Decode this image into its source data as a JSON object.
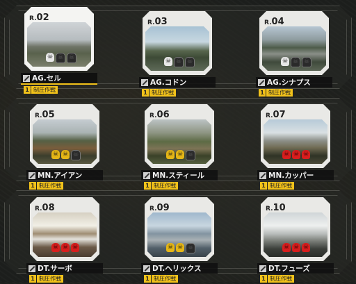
{
  "maps": [
    {
      "r": "R.",
      "num": "02",
      "name": "AG.セル",
      "mode": "制圧作戦",
      "count": "1",
      "skulls": [
        "white",
        "empty",
        "empty"
      ],
      "selected": true,
      "photo": "linear-gradient(180deg,#cfd3d6 0%,#b6bcbf 40%,#6f7468 55%,#59624c 70%,#7b7f6c 100%)"
    },
    {
      "r": "R.",
      "num": "03",
      "name": "AG.コドン",
      "mode": "制圧作戦",
      "count": "1",
      "skulls": [
        "white",
        "empty",
        "empty"
      ],
      "selected": false,
      "photo": "linear-gradient(180deg,#a7c2d4 0%,#c7d7e0 35%,#57664d 55%,#3d4a36 70%,#5e6a58 100%)"
    },
    {
      "r": "R.",
      "num": "04",
      "name": "AG.シナプス",
      "mode": "制圧作戦",
      "count": "1",
      "skulls": [
        "white",
        "empty",
        "empty"
      ],
      "selected": false,
      "photo": "linear-gradient(180deg,#b6c6d2 0%,#8f9c9f 30%,#4e5c4a 48%,#8a8f88 62%,#3f4a3b 80%,#5c6656 100%)"
    },
    {
      "r": "R.",
      "num": "05",
      "name": "MN.アイアン",
      "mode": "制圧作戦",
      "count": "1",
      "skulls": [
        "gold",
        "gold",
        "empty"
      ],
      "selected": false,
      "photo": "linear-gradient(180deg,#c5ccd1 0%,#aab3b3 30%,#556045 48%,#7a5d3c 65%,#3a3d2c 82%,#5a5940 100%)"
    },
    {
      "r": "R.",
      "num": "06",
      "name": "MN.スティール",
      "mode": "制圧作戦",
      "count": "1",
      "skulls": [
        "gold",
        "gold",
        "empty"
      ],
      "selected": false,
      "photo": "linear-gradient(180deg,#bcc3c4 0%,#8e9583 30%,#5d6a45 50%,#7d7456 66%,#3a4128 82%,#56603e 100%)"
    },
    {
      "r": "R.",
      "num": "07",
      "name": "MN.カッパー",
      "mode": "制圧作戦",
      "count": "1",
      "skulls": [
        "red",
        "red",
        "red"
      ],
      "selected": false,
      "photo": "linear-gradient(180deg,#b7cad8 0%,#d9e0e3 30%,#8c8f88 48%,#6f6a52 64%,#2f3325 82%,#4b4a38 100%)"
    },
    {
      "r": "R.",
      "num": "08",
      "name": "DT.サーボ",
      "mode": "制圧作戦",
      "count": "1",
      "skulls": [
        "red",
        "red",
        "red"
      ],
      "selected": false,
      "photo": "linear-gradient(180deg,#d6d0c2 0%,#f1efe6 30%,#9f8e74 48%,#e4e2dc 60%,#6b5a48 78%,#4a3d30 100%)"
    },
    {
      "r": "R.",
      "num": "09",
      "name": "DT.ヘリックス",
      "mode": "制圧作戦",
      "count": "1",
      "skulls": [
        "gold",
        "gold",
        "empty"
      ],
      "selected": false,
      "photo": "linear-gradient(180deg,#9fb7cc 0%,#c8d6e0 30%,#8294a1 48%,#a8b0b4 62%,#53606a 80%,#39434a 100%)"
    },
    {
      "r": "R.",
      "num": "10",
      "name": "DT.フューズ",
      "mode": "制圧作戦",
      "count": "1",
      "skulls": [
        "red",
        "red",
        "red"
      ],
      "selected": false,
      "photo": "linear-gradient(180deg,#cfd5d7 0%,#eef0ef 30%,#b9bdbb 48%,#7a7e78 64%,#3b3f3a 82%,#2b2e2a 100%)"
    }
  ]
}
